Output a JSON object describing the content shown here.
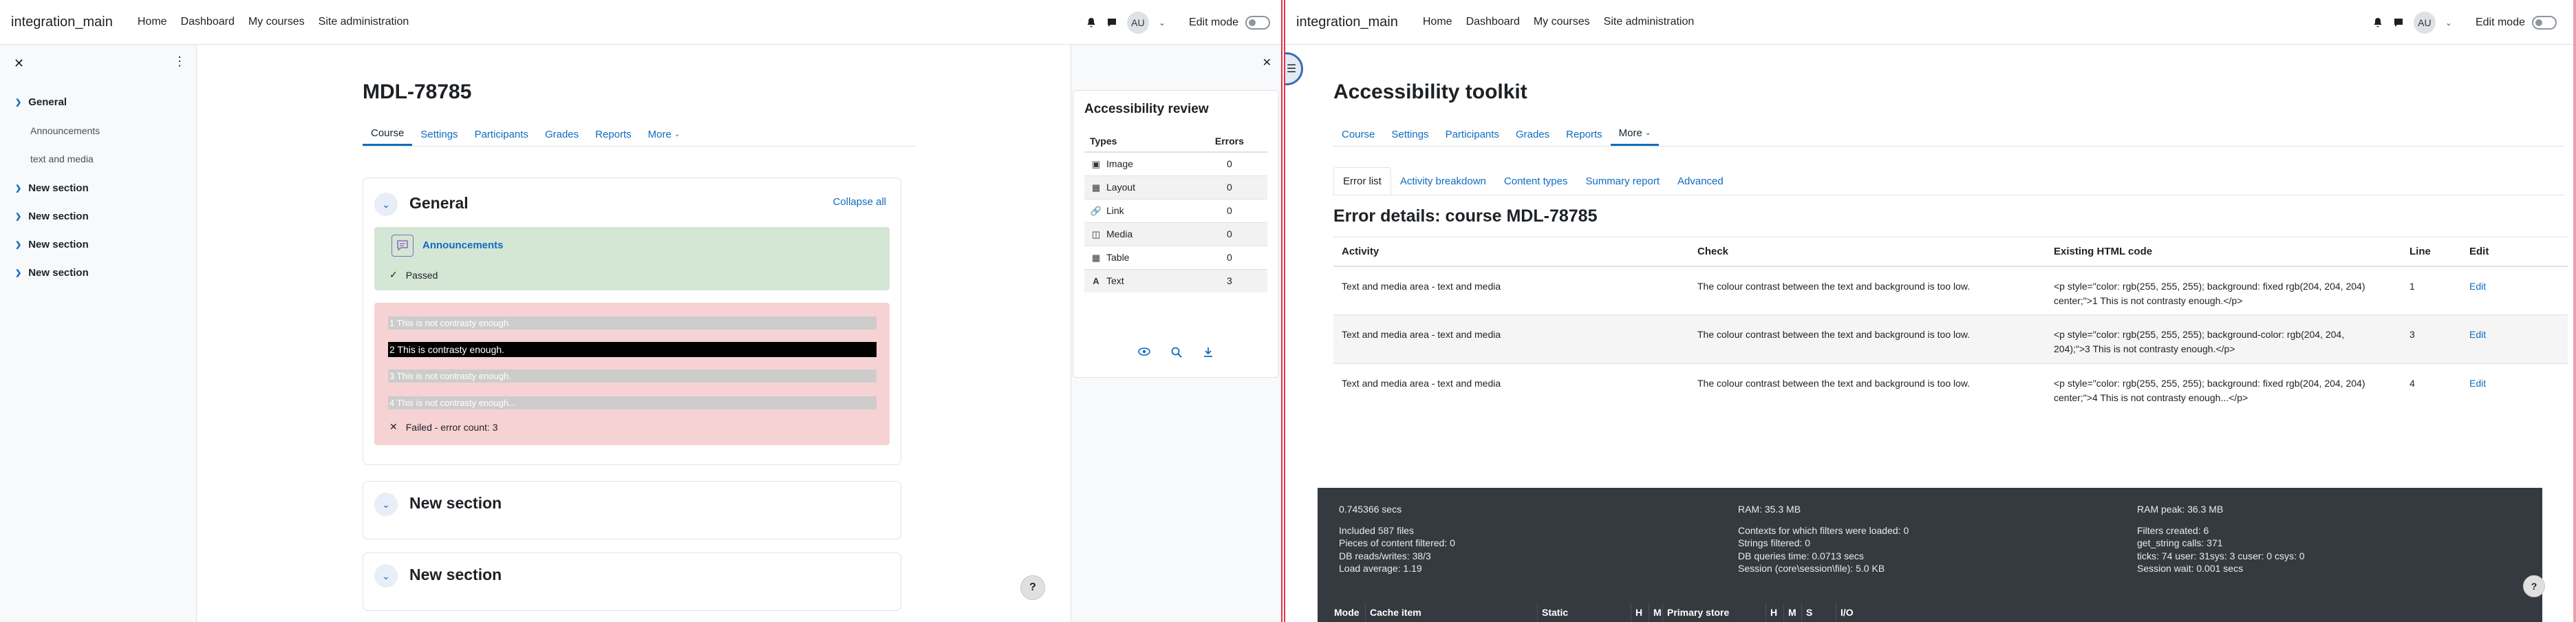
{
  "left": {
    "navbar": {
      "brand": "integration_main",
      "links": [
        "Home",
        "Dashboard",
        "My courses",
        "Site administration"
      ],
      "avatar": "AU",
      "edit_mode": "Edit mode"
    },
    "course_index": {
      "sections": [
        {
          "title": "General",
          "items": [
            "Announcements",
            "text and media"
          ]
        },
        {
          "title": "New section",
          "items": []
        },
        {
          "title": "New section",
          "items": []
        },
        {
          "title": "New section",
          "items": []
        },
        {
          "title": "New section",
          "items": []
        }
      ]
    },
    "page_title": "MDL-78785",
    "tabs": [
      "Course",
      "Settings",
      "Participants",
      "Grades",
      "Reports",
      "More"
    ],
    "general_section": {
      "title": "General",
      "collapse_all": "Collapse all",
      "announcements": "Announcements",
      "passed": "Passed",
      "contrast_lines": [
        "1 This is not contrasty enough.",
        "2 This is contrasty enough.",
        "3 This is not contrasty enough.",
        "4 This is not contrasty enough..."
      ],
      "failed": "Failed - error count: 3"
    },
    "more_sections": [
      "New section",
      "New section"
    ],
    "help": "?",
    "accessibility_review": {
      "title": "Accessibility review",
      "col_types": "Types",
      "col_errors": "Errors",
      "rows": [
        {
          "type": "Image",
          "errors": "0",
          "icon": "image-icon"
        },
        {
          "type": "Layout",
          "errors": "0",
          "icon": "table-layout-icon"
        },
        {
          "type": "Link",
          "errors": "0",
          "icon": "link-icon"
        },
        {
          "type": "Media",
          "errors": "0",
          "icon": "media-icon"
        },
        {
          "type": "Table",
          "errors": "0",
          "icon": "table-icon"
        },
        {
          "type": "Text",
          "errors": "3",
          "icon": "text-icon"
        }
      ]
    }
  },
  "right": {
    "navbar": {
      "brand": "integration_main",
      "links": [
        "Home",
        "Dashboard",
        "My courses",
        "Site administration"
      ],
      "avatar": "AU",
      "edit_mode": "Edit mode"
    },
    "page_title": "Accessibility toolkit",
    "tabs": [
      "Course",
      "Settings",
      "Participants",
      "Grades",
      "Reports",
      "More"
    ],
    "subtabs": [
      "Error list",
      "Activity breakdown",
      "Content types",
      "Summary report",
      "Advanced"
    ],
    "error_title": "Error details: course MDL-78785",
    "columns": [
      "Activity",
      "Check",
      "Existing HTML code",
      "Line",
      "Edit"
    ],
    "rows": [
      {
        "activity": "Text and media area - text and media",
        "check": "The colour contrast between the text and background is too low.",
        "code1": "<p style=\"color: rgb(255, 255, 255); background: fixed rgb(204, 204, 204)",
        "code2": "center;\">1 This is not contrasty enough.</p>",
        "line": "1",
        "edit": "Edit"
      },
      {
        "activity": "Text and media area - text and media",
        "check": "The colour contrast between the text and background is too low.",
        "code1": "<p style=\"color: rgb(255, 255, 255); background-color: rgb(204, 204,",
        "code2": "204);\">3 This is not contrasty enough.</p>",
        "line": "3",
        "edit": "Edit"
      },
      {
        "activity": "Text and media area - text and media",
        "check": "The colour contrast between the text and background is too low.",
        "code1": "<p style=\"color: rgb(255, 255, 255); background: fixed rgb(204, 204, 204)",
        "code2": "center;\">4 This is not contrasty enough...</p>",
        "line": "4",
        "edit": "Edit"
      }
    ],
    "perf": {
      "col1": [
        "0.745366 secs",
        "",
        "Included 587 files",
        "Pieces of content filtered: 0",
        "DB reads/writes: 38/3",
        "Load average: 1.19"
      ],
      "col2": [
        "RAM: 35.3 MB",
        "",
        "Contexts for which filters were loaded: 0",
        "Strings filtered: 0",
        "DB queries time: 0.0713 secs",
        "Session (core\\session\\file): 5.0 KB"
      ],
      "col3": [
        "RAM peak: 36.3 MB",
        "",
        "Filters created: 6",
        "get_string calls: 371",
        "ticks: 74 user: 31sys: 3 cuser: 0 csys: 0",
        "Session wait: 0.001 secs"
      ],
      "table_headers": [
        "Mode",
        "Cache item",
        "Static",
        "H",
        "M",
        "Primary store",
        "H",
        "M",
        "S",
        "I/O"
      ]
    },
    "help": "?"
  }
}
